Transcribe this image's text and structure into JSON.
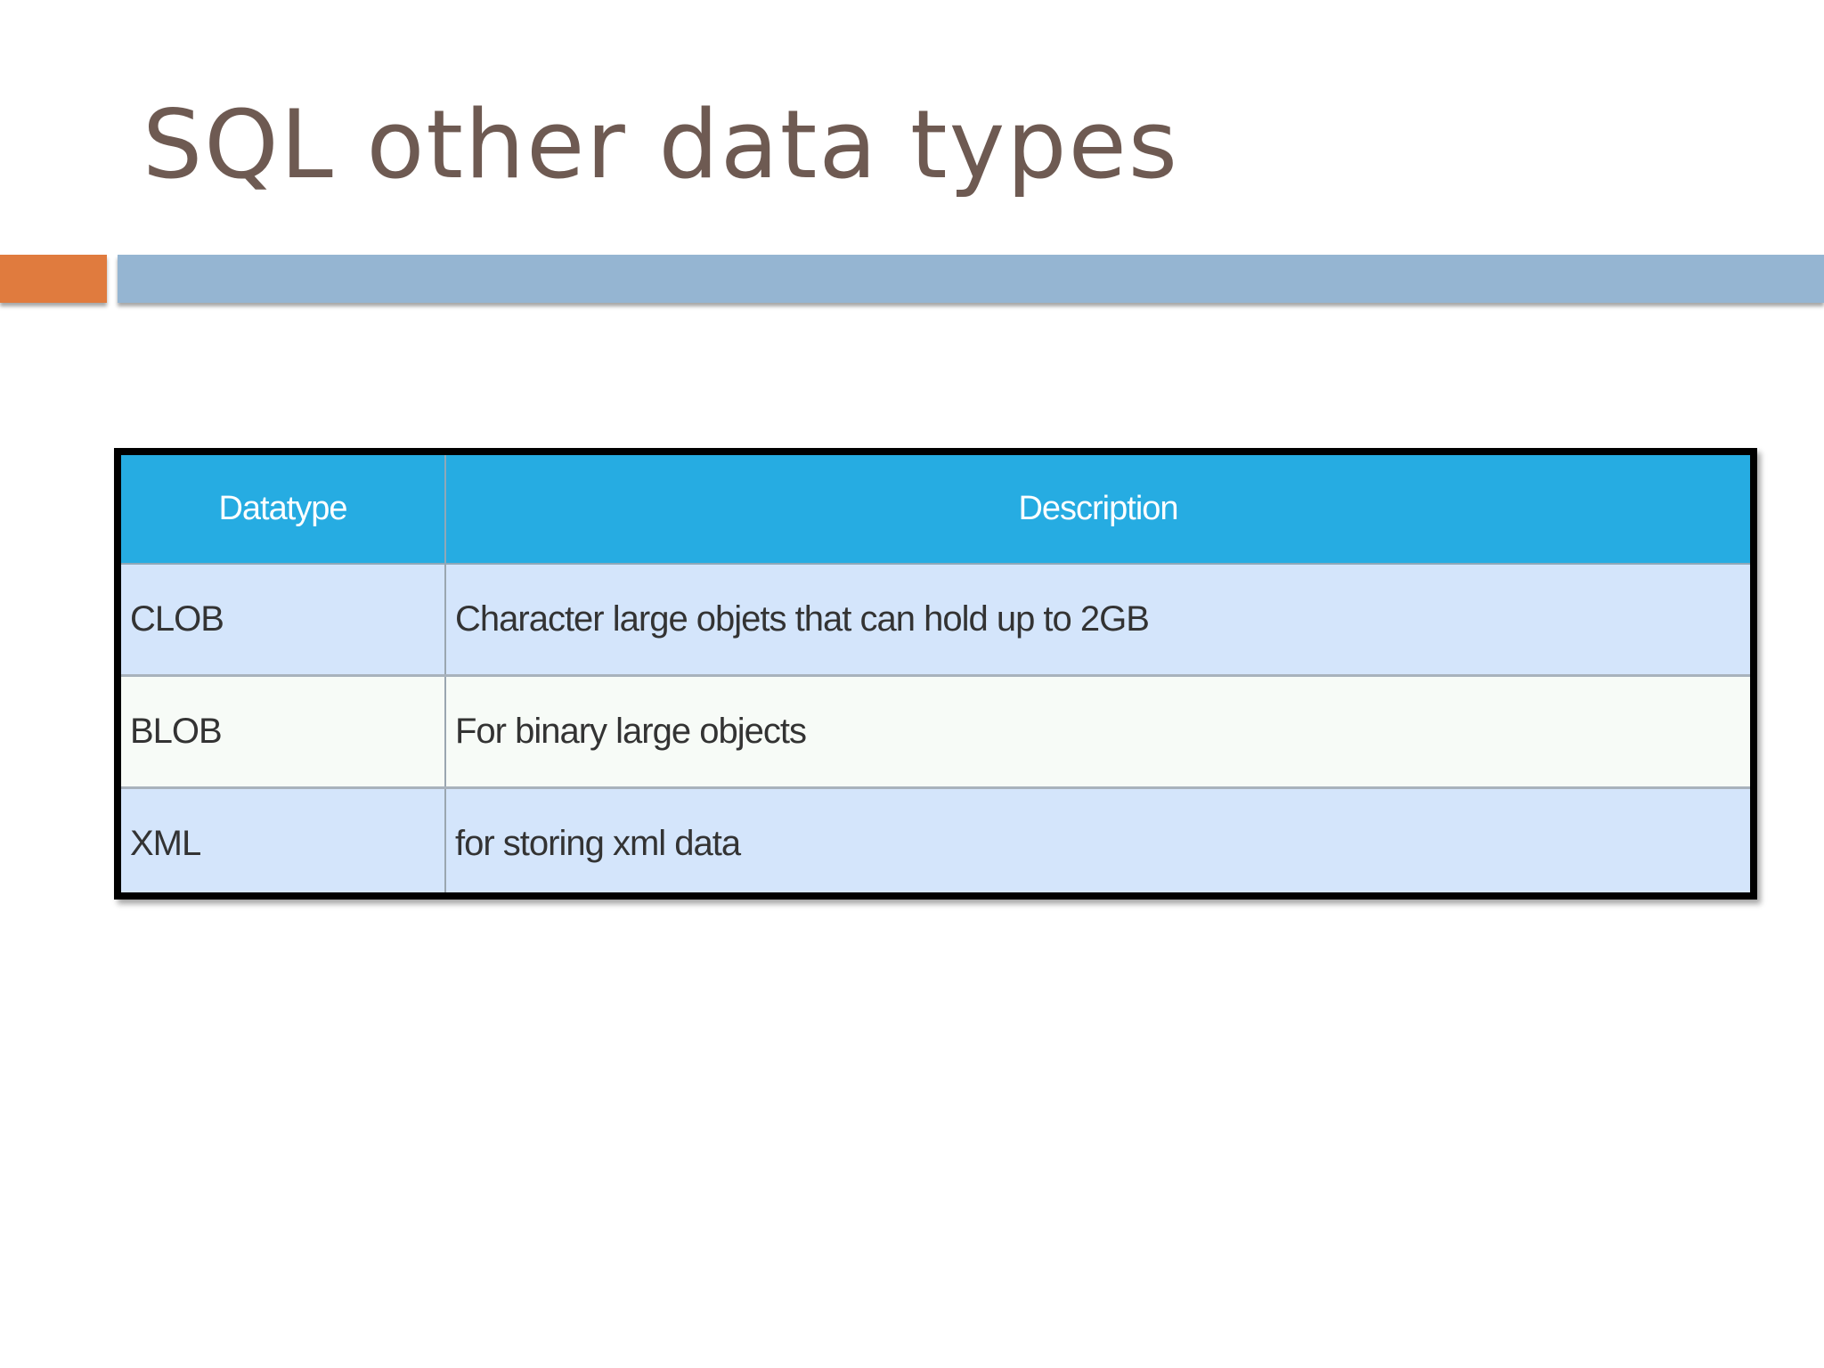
{
  "slide": {
    "title": "SQL other data types"
  },
  "table": {
    "headers": [
      "Datatype",
      "Description"
    ],
    "rows": [
      {
        "datatype": "CLOB",
        "description": "Character large objets that can hold up to 2GB"
      },
      {
        "datatype": "BLOB",
        "description": "For binary large objects"
      },
      {
        "datatype": "XML",
        "description": "for storing xml data"
      }
    ]
  },
  "colors": {
    "title_text": "#6e5a52",
    "accent_orange": "#e07b3e",
    "accent_blue": "#95b5d2",
    "header_bg": "#26ace2",
    "row_blue": "#d4e5fb",
    "row_white": "#f7fbf7"
  }
}
